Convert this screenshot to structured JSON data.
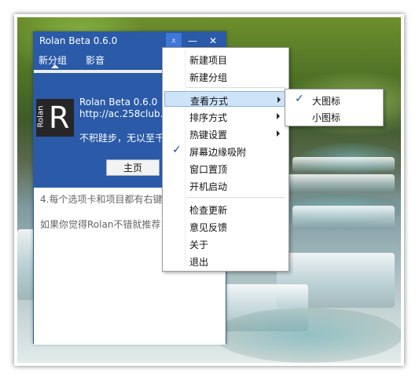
{
  "window": {
    "title": "Rolan Beta 0.6.0",
    "menu_glyph": "⩡",
    "minimize_glyph": "—",
    "close_glyph": "✕"
  },
  "tabs": [
    "新分组",
    "影音"
  ],
  "about": {
    "logo_word": "Rolan",
    "logo_letter": "R",
    "app_name": "Rolan Beta 0.6.0",
    "url": "http://ac.258club.c",
    "slogan": "不积跬步，无以至千",
    "home_button": "主页"
  },
  "tips": [
    "4.每个选项卡和项目都有右键",
    "如果你觉得Rolan不错就推荐"
  ],
  "menu": {
    "items": [
      {
        "label": "新建项目",
        "submenu": false,
        "checked": false
      },
      {
        "label": "新建分组",
        "submenu": false,
        "checked": false
      },
      {
        "label": "查看方式",
        "submenu": true,
        "checked": false,
        "highlighted": true
      },
      {
        "label": "排序方式",
        "submenu": true,
        "checked": false
      },
      {
        "label": "热键设置",
        "submenu": true,
        "checked": false
      },
      {
        "label": "屏幕边缘吸附",
        "submenu": false,
        "checked": true
      },
      {
        "label": "窗口置顶",
        "submenu": false,
        "checked": false
      },
      {
        "label": "开机启动",
        "submenu": false,
        "checked": false
      },
      {
        "label": "检查更新",
        "submenu": false,
        "checked": false
      },
      {
        "label": "意见反馈",
        "submenu": false,
        "checked": false
      },
      {
        "label": "关于",
        "submenu": false,
        "checked": false
      },
      {
        "label": "退出",
        "submenu": false,
        "checked": false
      }
    ],
    "check_glyph": "✓"
  },
  "submenu": {
    "items": [
      {
        "label": "大图标",
        "checked": true
      },
      {
        "label": "小图标",
        "checked": false
      }
    ]
  },
  "colors": {
    "titlebar": "#2a5aa8",
    "menu_highlight": "#cde3f8",
    "check": "#1a50a8"
  }
}
